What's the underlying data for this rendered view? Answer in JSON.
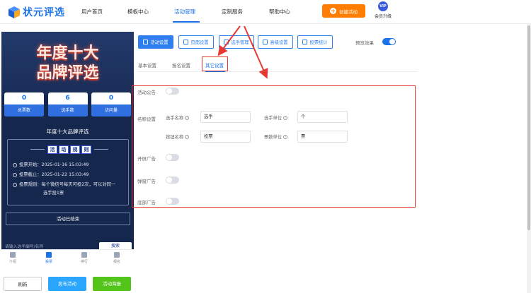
{
  "brand": {
    "logo_text": "状元评选"
  },
  "nav": {
    "items": [
      "用户首页",
      "模板中心",
      "活动管理",
      "定制服务",
      "帮助中心"
    ],
    "active_index": 2,
    "create_button": "创建活动",
    "vip_badge": "VIP",
    "vip_label": "会员升级"
  },
  "preview": {
    "hero_line1": "年度十大",
    "hero_line2": "品牌评选",
    "stats": [
      {
        "value": "0",
        "label": "总票数"
      },
      {
        "value": "6",
        "label": "选手数"
      },
      {
        "value": "0",
        "label": "访问量"
      }
    ],
    "title": "年度十大品牌评选",
    "rules_chips": [
      "活",
      "动",
      "规",
      "则"
    ],
    "rules": [
      "投票开始：2025-01-16 15:03:49",
      "投票截止：2025-01-22 15:03:49",
      "投票规则：每个微信号每天可投2次，可以对同一",
      "选手投1票"
    ],
    "ended": "活动已结束",
    "search_placeholder": "请输入选手编号/名称",
    "search_button": "搜索",
    "tabs": [
      "介绍",
      "投票",
      "排行",
      "报名"
    ],
    "active_tab": 1
  },
  "actions": {
    "refresh": "刷新",
    "publish": "发布活动",
    "poster": "活动海报"
  },
  "toolbar": {
    "buttons": [
      "活动设置",
      "页面设置",
      "选手管理",
      "高级设置",
      "投票统计"
    ],
    "preview_label": "预览效果",
    "preview_on": true
  },
  "subtabs": {
    "items": [
      "基本设置",
      "报名设置",
      "其它设置"
    ],
    "active_index": 2
  },
  "settings": {
    "announcement": {
      "label": "活动公告",
      "on": false
    },
    "naming": {
      "label": "名称设置",
      "player_name_label": "选手名称",
      "player_name_value": "选手",
      "player_unit_label": "选手单位",
      "player_unit_value": "个",
      "button_name_label": "按钮名称",
      "button_name_value": "投票",
      "vote_unit_label": "票数单位",
      "vote_unit_value": "票"
    },
    "splash_ad": {
      "label": "开屏广告",
      "on": false
    },
    "popup_ad": {
      "label": "弹窗广告",
      "on": false
    },
    "bottom_ad": {
      "label": "底部广告",
      "on": false
    }
  },
  "colors": {
    "primary": "#1a73e8",
    "orange": "#ff7d00",
    "green": "#52c41a",
    "highlight": "#e53935",
    "phone_bg": "#16274d"
  }
}
